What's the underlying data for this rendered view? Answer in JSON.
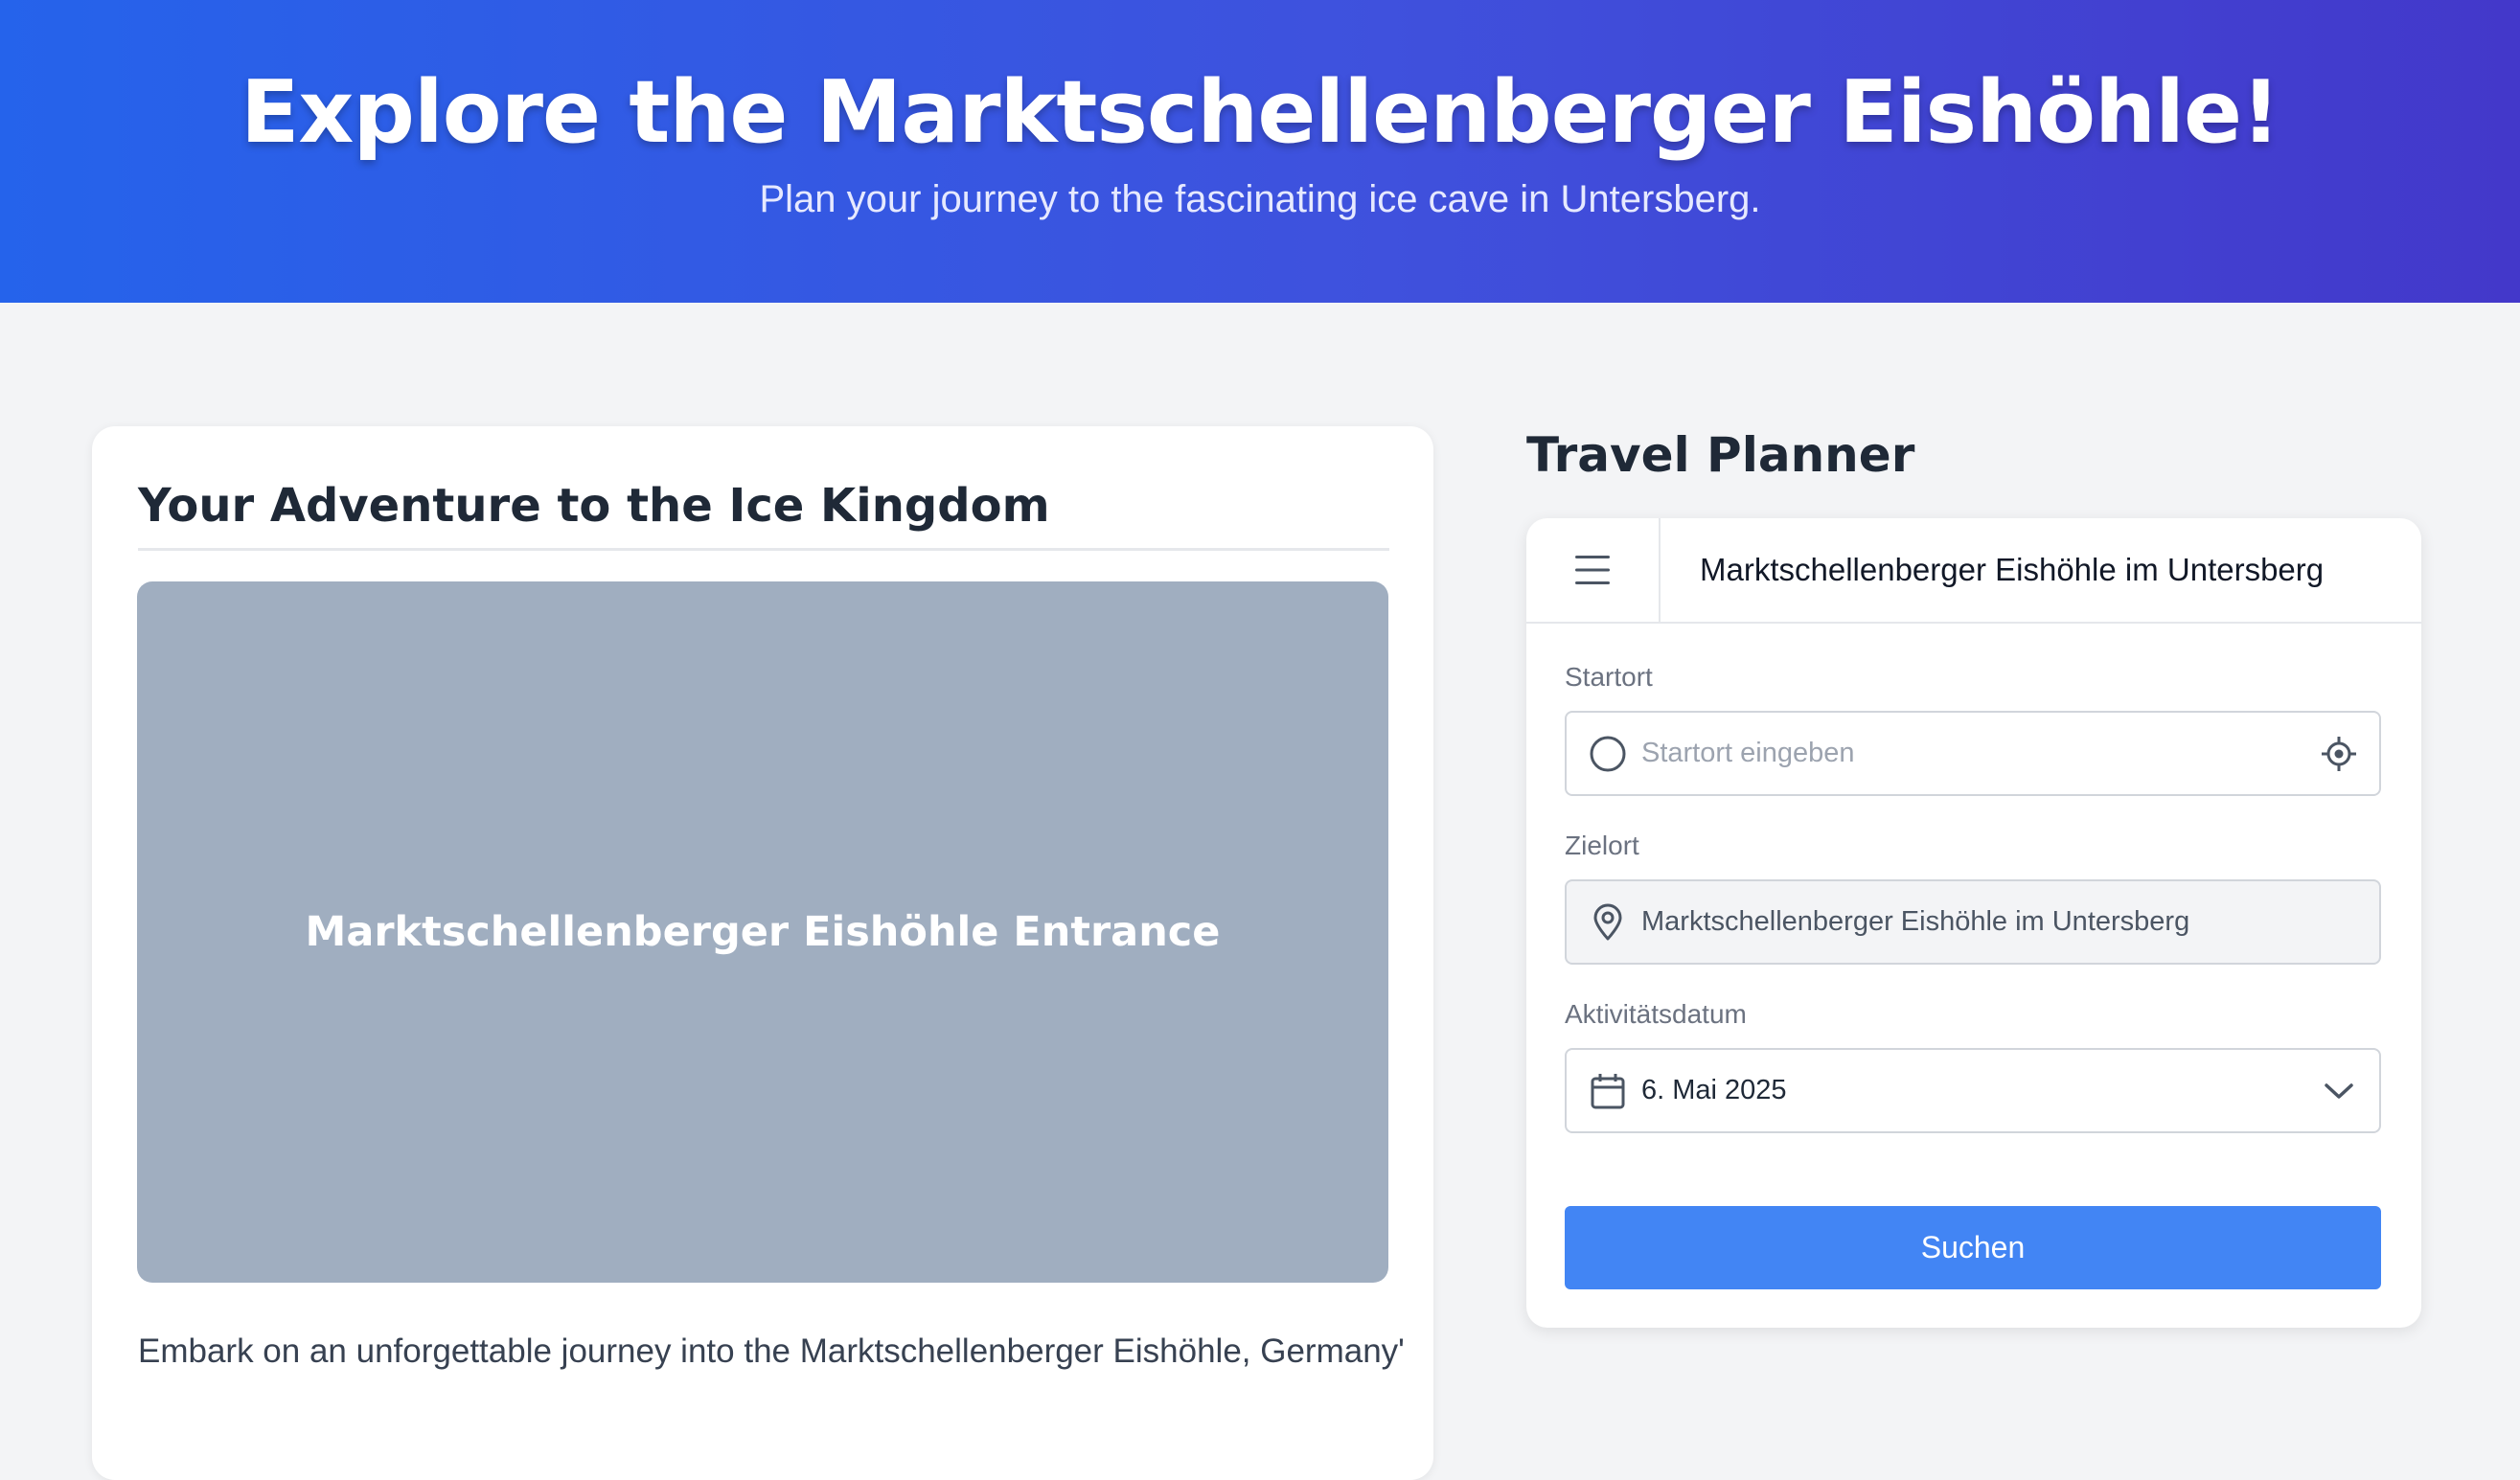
{
  "hero": {
    "title": "Explore the Marktschellenberger Eishöhle!",
    "subtitle": "Plan your journey to the fascinating ice cave in Untersberg."
  },
  "adventure": {
    "title": "Your Adventure to the Ice Kingdom",
    "image_label": "Marktschellenberger Eishöhle Entrance",
    "body": "Embark on an unforgettable journey into the Marktschellenberger Eishöhle, Germany's"
  },
  "planner": {
    "section_title": "Travel Planner",
    "header_title": "Marktschellenberger Eishöhle im Untersberg",
    "menu_icon": "menu-icon",
    "start": {
      "label": "Startort",
      "placeholder": "Startort eingeben",
      "value": "",
      "icon": "circle-icon",
      "action_icon": "locate-icon"
    },
    "destination": {
      "label": "Zielort",
      "value": "Marktschellenberger Eishöhle im Untersberg",
      "icon": "map-pin-icon"
    },
    "date": {
      "label": "Aktivitätsdatum",
      "value": "6. Mai 2025",
      "icon": "calendar-icon",
      "dropdown_icon": "chevron-down-icon"
    },
    "search_label": "Suchen"
  },
  "colors": {
    "hero_gradient_start": "#2563eb",
    "hero_gradient_end": "#4338ca",
    "button": "#4285f4",
    "image_placeholder": "#a0aec0",
    "background": "#f3f4f6"
  }
}
